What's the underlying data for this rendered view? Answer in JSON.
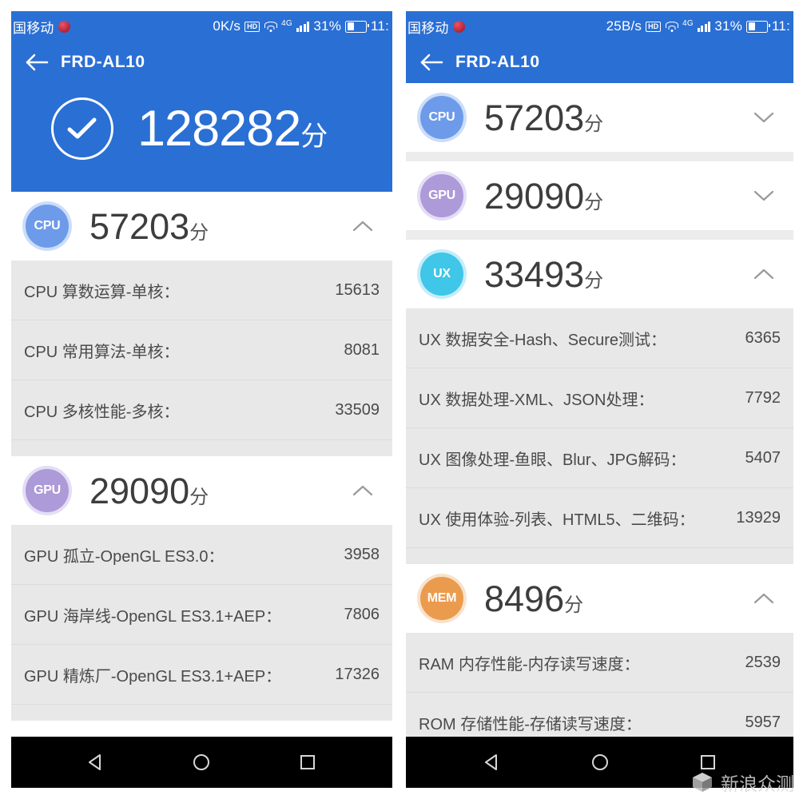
{
  "meta": {
    "accent_blue": "#2a6fd4",
    "row_bg": "#e8e8e8",
    "unit_suffix": "分"
  },
  "left_phone": {
    "status_bar": {
      "carrier": "国移动",
      "network_speed": "0K/s",
      "hd_label": "HD",
      "network_type": "4G",
      "battery_percent": "31%",
      "clock": "11:"
    },
    "title_bar": {
      "back_icon": "arrow-left-icon",
      "title": "FRD-AL10"
    },
    "hero": {
      "icon": "check-circle-icon",
      "score": "128282",
      "unit": "分"
    },
    "sections": [
      {
        "key": "cpu",
        "badge_label": "CPU",
        "badge_color": "#6d9bea",
        "score": "57203",
        "unit": "分",
        "expanded": true,
        "chevron": "chevron-up-icon",
        "rows": [
          {
            "label": "CPU 算数运算-单核：",
            "value": "15613"
          },
          {
            "label": "CPU 常用算法-单核：",
            "value": "8081"
          },
          {
            "label": "CPU 多核性能-多核：",
            "value": "33509"
          }
        ]
      },
      {
        "key": "gpu",
        "badge_label": "GPU",
        "badge_color": "#ad9ad8",
        "score": "29090",
        "unit": "分",
        "expanded": true,
        "chevron": "chevron-up-icon",
        "rows": [
          {
            "label": "GPU 孤立-OpenGL ES3.0：",
            "value": "3958"
          },
          {
            "label": "GPU 海岸线-OpenGL ES3.1+AEP：",
            "value": "7806"
          },
          {
            "label": "GPU 精炼厂-OpenGL ES3.1+AEP：",
            "value": "17326"
          }
        ]
      }
    ],
    "nav_bar": {
      "back": "triangle-back-icon",
      "home": "circle-home-icon",
      "recents": "square-recents-icon"
    }
  },
  "right_phone": {
    "status_bar": {
      "carrier": "国移动",
      "network_speed": "25B/s",
      "hd_label": "HD",
      "network_type": "4G",
      "battery_percent": "31%",
      "clock": "11:"
    },
    "title_bar": {
      "back_icon": "arrow-left-icon",
      "title": "FRD-AL10"
    },
    "sections": [
      {
        "key": "cpu",
        "badge_label": "CPU",
        "badge_color": "#6d9bea",
        "score": "57203",
        "unit": "分",
        "expanded": false,
        "chevron": "chevron-down-icon",
        "rows": []
      },
      {
        "key": "gpu",
        "badge_label": "GPU",
        "badge_color": "#ad9ad8",
        "score": "29090",
        "unit": "分",
        "expanded": false,
        "chevron": "chevron-down-icon",
        "rows": []
      },
      {
        "key": "ux",
        "badge_label": "UX",
        "badge_color": "#3fc6e8",
        "score": "33493",
        "unit": "分",
        "expanded": true,
        "chevron": "chevron-up-icon",
        "rows": [
          {
            "label": "UX 数据安全-Hash、Secure测试：",
            "value": "6365"
          },
          {
            "label": "UX 数据处理-XML、JSON处理：",
            "value": "7792"
          },
          {
            "label": "UX 图像处理-鱼眼、Blur、JPG解码：",
            "value": "5407"
          },
          {
            "label": "UX 使用体验-列表、HTML5、二维码：",
            "value": "13929"
          }
        ]
      },
      {
        "key": "mem",
        "badge_label": "MEM",
        "badge_color": "#eb9b4d",
        "score": "8496",
        "unit": "分",
        "expanded": true,
        "chevron": "chevron-up-icon",
        "rows": [
          {
            "label": "RAM 内存性能-内存读写速度：",
            "value": "2539"
          },
          {
            "label": "ROM 存储性能-存储读写速度：",
            "value": "5957"
          }
        ]
      }
    ],
    "nav_bar": {
      "back": "triangle-back-icon",
      "home": "circle-home-icon",
      "recents": "square-recents-icon"
    }
  },
  "watermark": {
    "logo": "cube-logo-icon",
    "text": "新浪众测"
  }
}
